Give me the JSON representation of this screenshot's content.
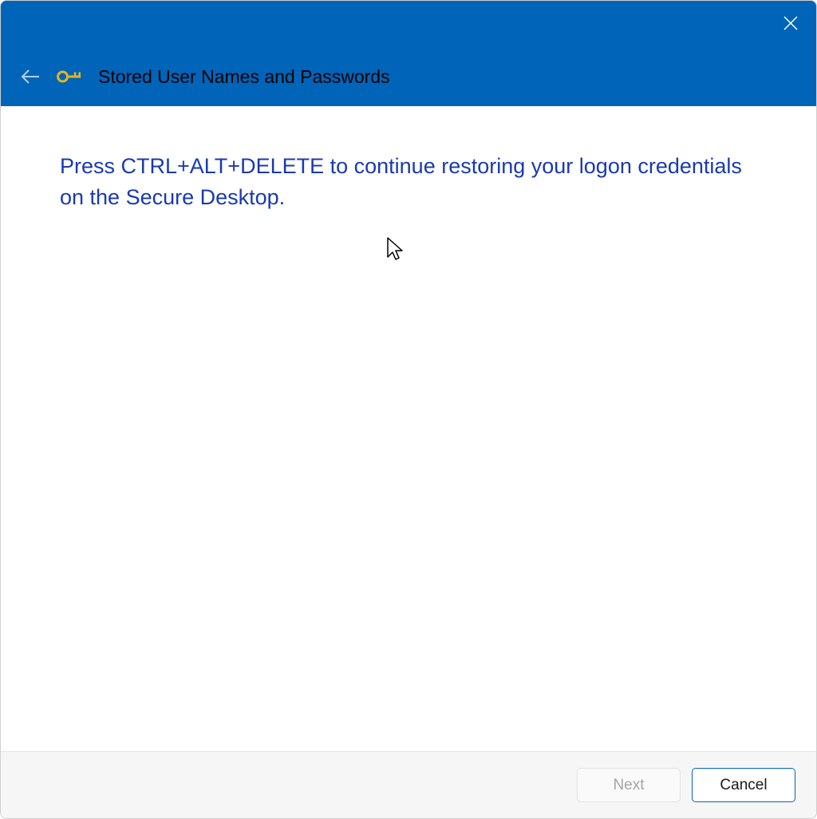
{
  "header": {
    "title": "Stored User Names and Passwords"
  },
  "content": {
    "instruction": "Press CTRL+ALT+DELETE to continue restoring your logon credentials on the Secure Desktop."
  },
  "footer": {
    "next_label": "Next",
    "cancel_label": "Cancel"
  }
}
